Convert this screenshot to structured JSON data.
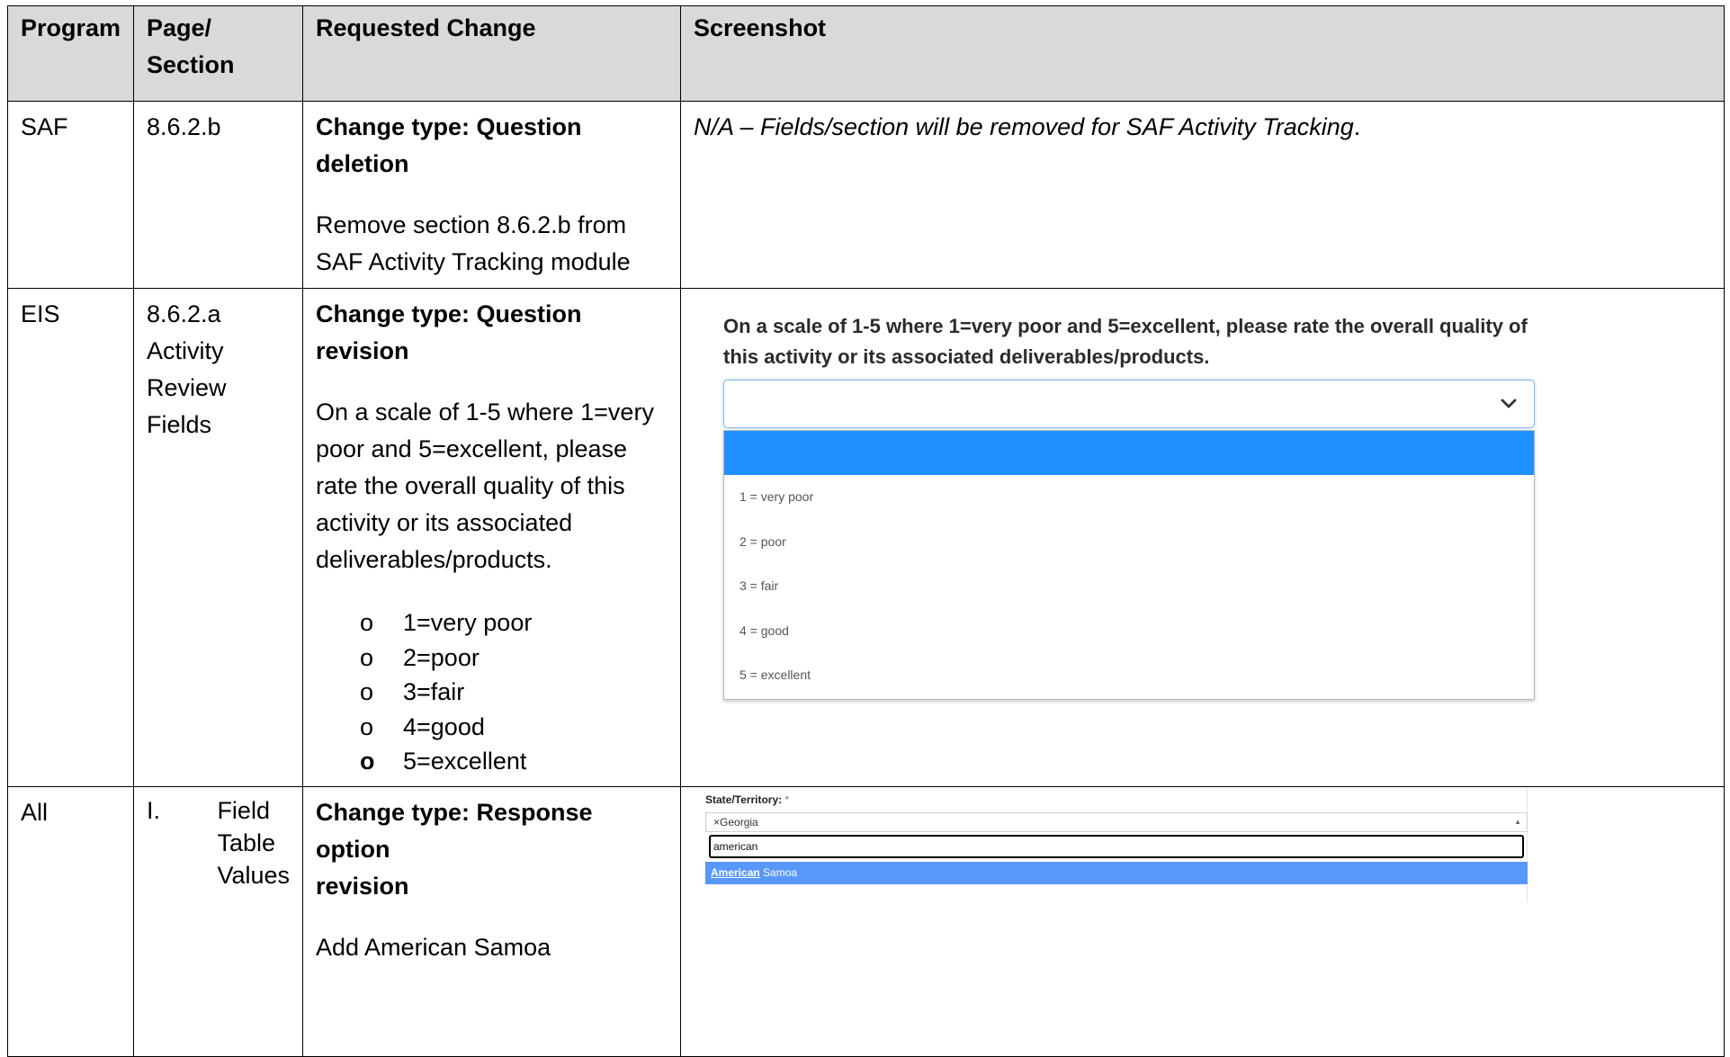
{
  "headers": {
    "program": "Program",
    "page_line1": "Page/",
    "page_line2": "Section",
    "change": "Requested Change",
    "screenshot": "Screenshot"
  },
  "rows": [
    {
      "program": "SAF",
      "page": "8.6.2.b",
      "change_type": "Change type: Question deletion",
      "change_text": "Remove section 8.6.2.b from SAF Activity Tracking module",
      "screenshot_text_main": "N/A – Fields/section will be removed for SAF Activity Tracking",
      "screenshot_text_end": "."
    },
    {
      "program": "EIS",
      "page_line1": "8.6.2.a Activity",
      "page_line2": "Review Fields",
      "change_type": "Change type: Question revision",
      "change_text": "On a scale of 1-5 where 1=very poor and 5=excellent, please rate the overall quality of this activity or its associated deliverables/products.",
      "bullet_glyph": "o",
      "options": [
        "1=very poor",
        "2=poor",
        "3=fair",
        "4=good",
        "5=excellent"
      ],
      "screenshot": {
        "question": "On a scale of 1-5 where 1=very poor and 5=excellent, please rate the overall quality of this activity or its associated deliverables/products.",
        "dropdown_value": "",
        "dropdown_options": [
          "1 = very poor",
          "2 = poor",
          "3 = fair",
          "4 = good",
          "5 = excellent"
        ],
        "chevron_icon": "chevron-down-icon",
        "highlight_color": "#1e90ff"
      }
    },
    {
      "program": "All",
      "page_num": "I.",
      "page_lines": [
        "Field",
        "Table",
        "Values"
      ],
      "change_type_line1": "Change type: Response option",
      "change_type_line2": "revision",
      "change_text": "Add American Samoa",
      "screenshot": {
        "label": "State/Territory:",
        "required_mark": "*",
        "selected_remove": "×",
        "selected_value": "Georgia",
        "caret_icon": "caret-up-icon",
        "search_value": "american",
        "result_match": "American",
        "result_rest": " Samoa",
        "highlight_color": "#5897fb"
      }
    }
  ],
  "colors": {
    "header_bg": "#d9d9d9",
    "border": "#000000"
  }
}
